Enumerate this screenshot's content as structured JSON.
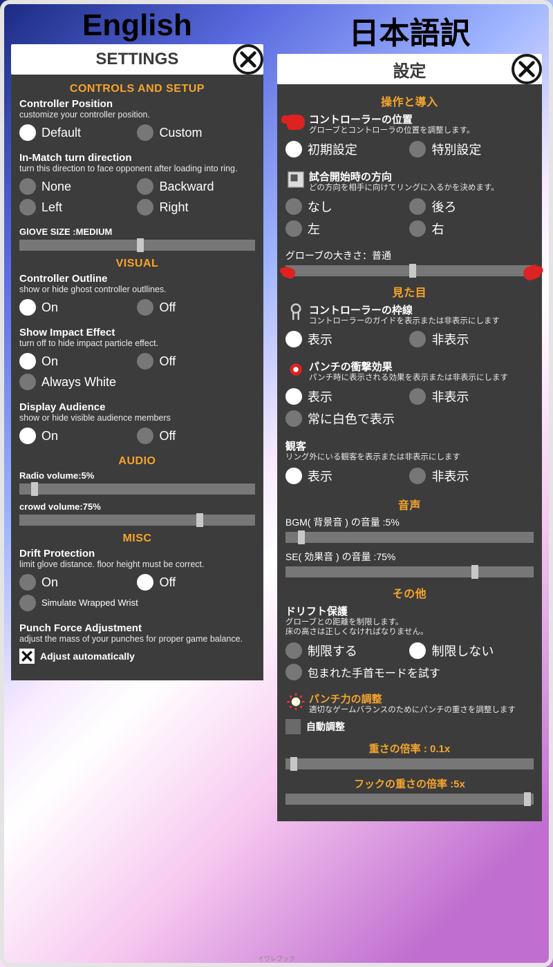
{
  "lang_labels": {
    "en": "English",
    "jp": "日本語訳"
  },
  "en": {
    "title": "SETTINGS",
    "sections": {
      "controls": "CONTROLS AND SETUP",
      "visual": "VISUAL",
      "audio": "AUDIO",
      "misc": "MISC"
    },
    "controller_position": {
      "title": "Controller Position",
      "desc": "customize your controller position.",
      "options": {
        "default": "Default",
        "custom": "Custom"
      },
      "selected": "default"
    },
    "turn_direction": {
      "title": "In-Match turn direction",
      "desc": "turn this direction to face opponent after loading into ring.",
      "options": {
        "none": "None",
        "backward": "Backward",
        "left": "Left",
        "right": "Right"
      }
    },
    "glove_size": {
      "label": "GlOVE SIZE :MEDIUM",
      "percent": 50
    },
    "controller_outline": {
      "title": "Controller Outline",
      "desc": "show or hide ghost controller outllines.",
      "options": {
        "on": "On",
        "off": "Off"
      },
      "selected": "on"
    },
    "impact_effect": {
      "title": "Show Impact Effect",
      "desc": "turn off to hide impact particle effect.",
      "options": {
        "on": "On",
        "off": "Off",
        "always_white": "Always White"
      },
      "selected": "on"
    },
    "display_audience": {
      "title": "Display Audience",
      "desc": "show or hide visible audience members",
      "options": {
        "on": "On",
        "off": "Off"
      },
      "selected": "on"
    },
    "radio_volume": {
      "label": "Radio volume:5%",
      "percent": 5
    },
    "crowd_volume": {
      "label": "crowd volume:75%",
      "percent": 75
    },
    "drift_protection": {
      "title": "Drift Protection",
      "desc": "limit glove distance. floor height must be correct.",
      "options": {
        "on": "On",
        "off": "Off",
        "wrist": "Simulate Wrapped Wrist"
      },
      "selected": "off"
    },
    "punch_force": {
      "title": "Punch Force Adjustment",
      "desc": "adjust the mass of your punches for proper game  balance.",
      "auto_label": "Adjust automatically",
      "auto_checked": true
    }
  },
  "jp": {
    "title": "設定",
    "sections": {
      "controls": "操作と導入",
      "visual": "見た目",
      "audio": "音声",
      "misc": "その他"
    },
    "controller_position": {
      "title": "コントローラーの位置",
      "desc": "グローブとコントローラの位置を調整します。",
      "options": {
        "default": "初期設定",
        "custom": "特別設定"
      },
      "selected": "default"
    },
    "turn_direction": {
      "title": "試合開始時の方向",
      "desc": "どの方向を相手に向けてリングに入るかを決めます。",
      "options": {
        "none": "なし",
        "backward": "後ろ",
        "left": "左",
        "right": "右"
      }
    },
    "glove_size": {
      "label": "グローブの大きさ：普通",
      "percent": 50
    },
    "controller_outline": {
      "title": "コントローラーの枠線",
      "desc": "コントローラーのガイドを表示または非表示にします",
      "options": {
        "on": "表示",
        "off": "非表示"
      },
      "selected": "on"
    },
    "impact_effect": {
      "title": "パンチの衝撃効果",
      "desc": "パンチ時に表示される効果を表示または非表示にします",
      "options": {
        "on": "表示",
        "off": "非表示",
        "always_white": "常に白色で表示"
      },
      "selected": "on"
    },
    "display_audience": {
      "title": "観客",
      "desc": "リング外にいる観客を表示または非表示にします",
      "options": {
        "on": "表示",
        "off": "非表示"
      },
      "selected": "on"
    },
    "radio_volume": {
      "label": "BGM( 背景音 ) の音量 :5%",
      "percent": 5
    },
    "crowd_volume": {
      "label": "SE( 効果音 ) の音量 :75%",
      "percent": 75
    },
    "drift_protection": {
      "title": "ドリフト保護",
      "desc": "グローブとの距離を制限します。\n床の高さは正しくなければなりません。",
      "options": {
        "on": "制限する",
        "off": "制限しない",
        "wrist": "包まれた手首モードを試す"
      },
      "selected": "off"
    },
    "punch_force": {
      "title": "パンチ力の調整",
      "desc": "適切なゲームバランスのためにパンチの重さを調整します",
      "auto_label": "自動調整",
      "auto_checked": false
    },
    "mass_multiplier": {
      "label": "重さの倍率 : 0.1x",
      "percent": 2
    },
    "hook_multiplier": {
      "label": "フックの重さの倍率 :5x",
      "percent": 98
    }
  },
  "footer": "イワレブック"
}
